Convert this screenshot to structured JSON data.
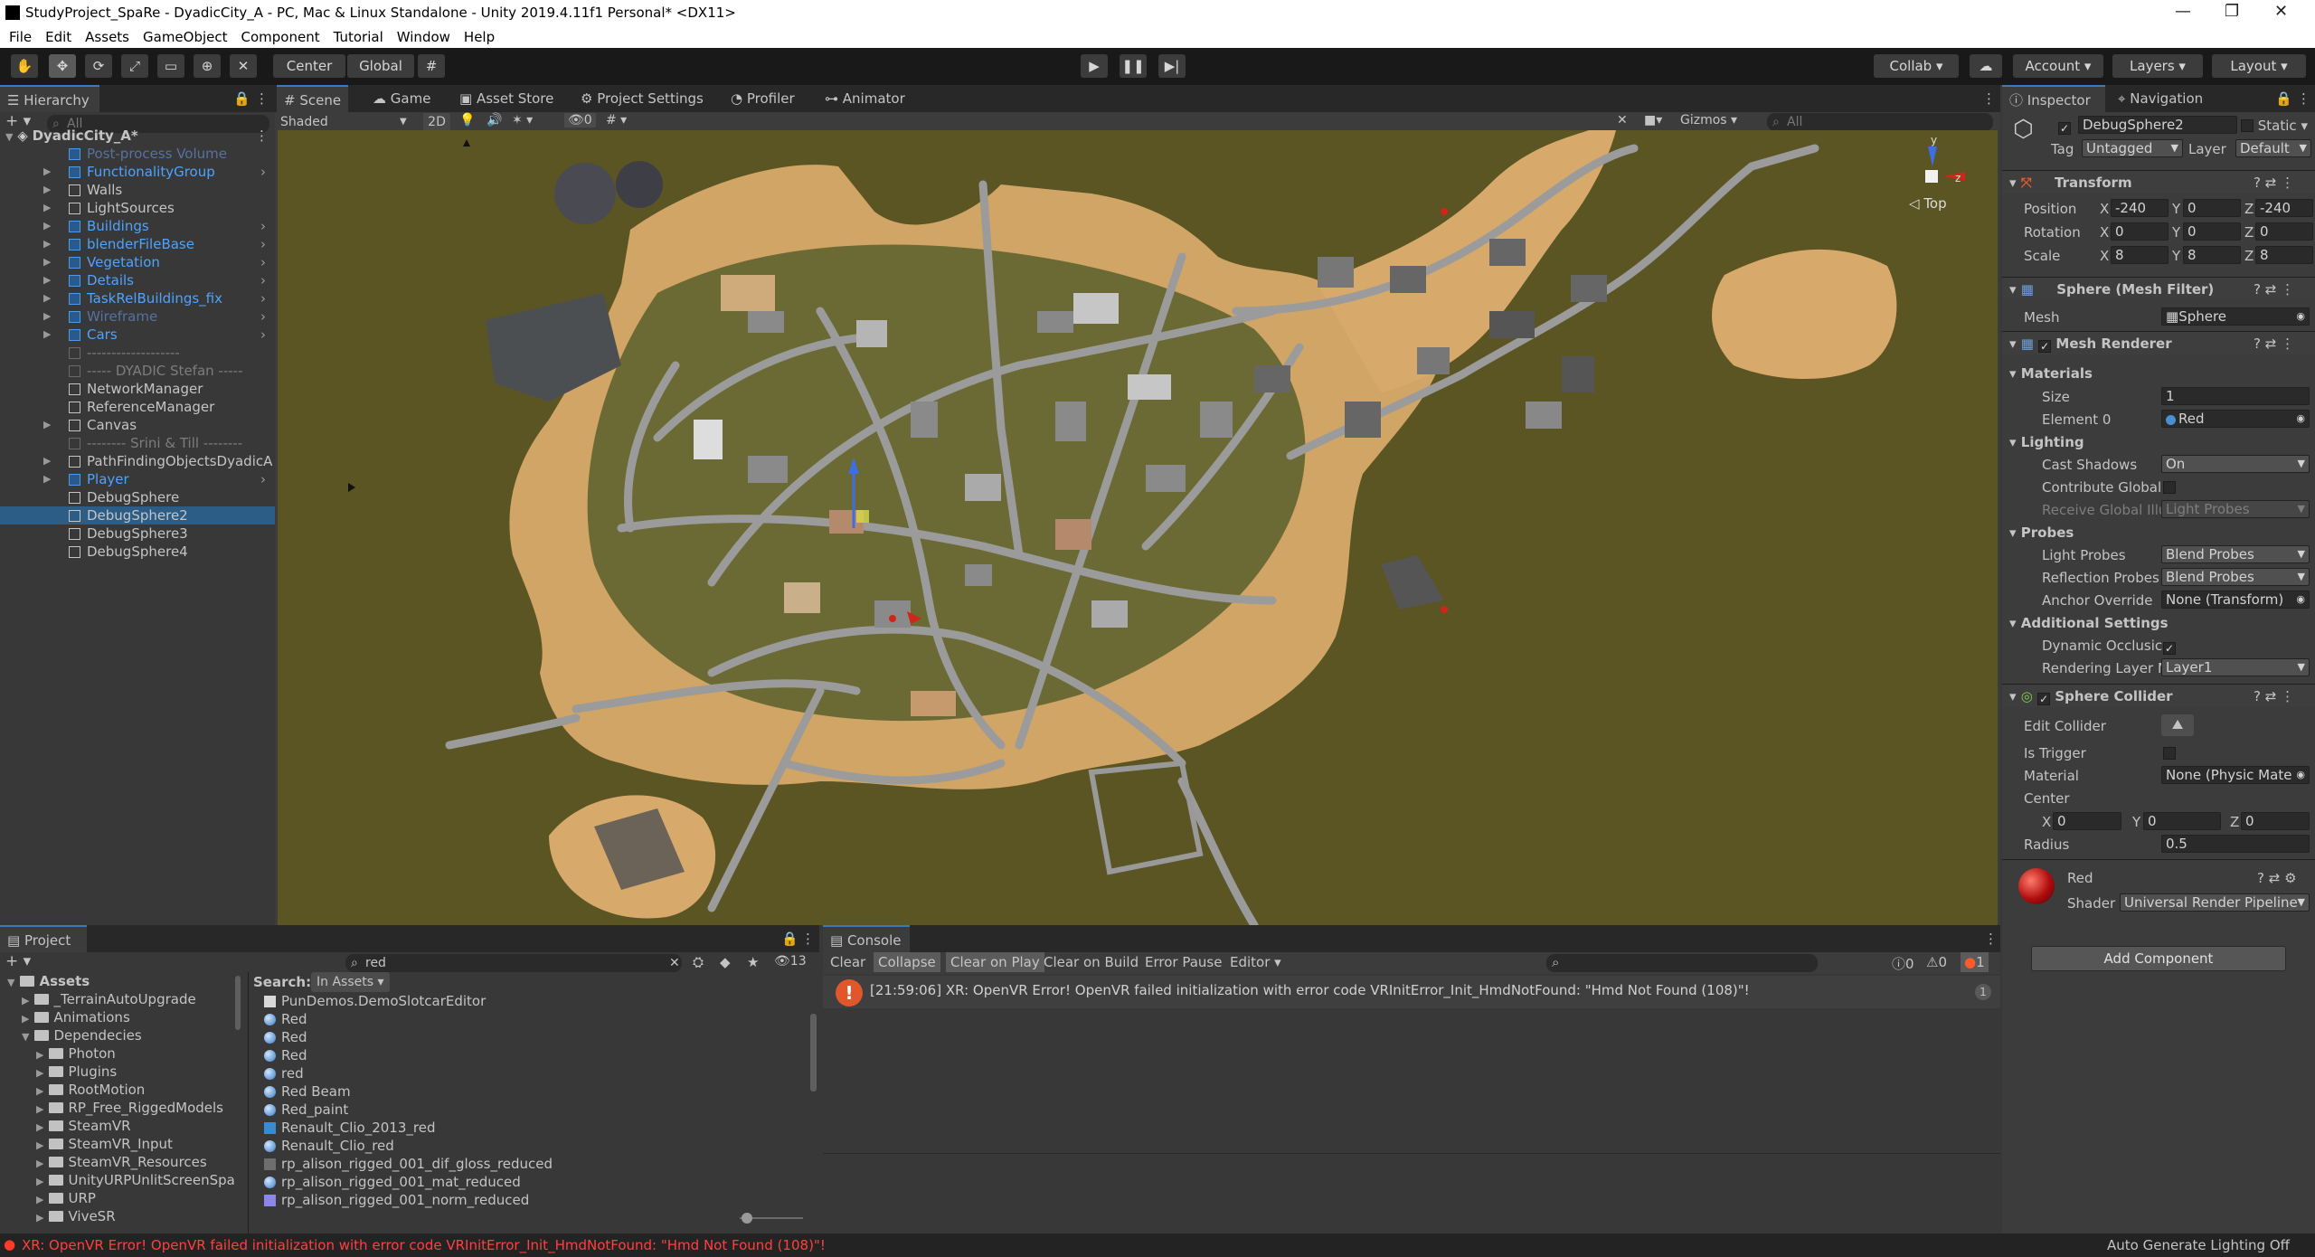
{
  "titlebar": {
    "title": "StudyProject_SpaRe - DyadicCity_A - PC, Mac & Linux Standalone - Unity 2019.4.11f1 Personal* <DX11>",
    "minimize": "—",
    "maximize": "❐",
    "close": "✕"
  },
  "menu": [
    "File",
    "Edit",
    "Assets",
    "GameObject",
    "Component",
    "Tutorial",
    "Window",
    "Help"
  ],
  "toolbar": {
    "pivot": "Center",
    "space": "Global",
    "collab": "Collab ▾",
    "account": "Account",
    "layers": "Layers",
    "layout": "Layout"
  },
  "hierarchy": {
    "tab": "Hierarchy",
    "search_placeholder": "All",
    "scene": "DyadicCity_A*",
    "items": [
      {
        "label": "Post-process Volume",
        "style": "dim-blue"
      },
      {
        "label": "FunctionalityGroup",
        "style": "blue"
      },
      {
        "label": "Walls",
        "style": "normal"
      },
      {
        "label": "LightSources",
        "style": "normal"
      },
      {
        "label": "Buildings",
        "style": "blue"
      },
      {
        "label": "blenderFileBase",
        "style": "blue"
      },
      {
        "label": "Vegetation",
        "style": "blue"
      },
      {
        "label": "Details",
        "style": "blue"
      },
      {
        "label": "TaskRelBuildings_fix",
        "style": "blue"
      },
      {
        "label": "Wireframe",
        "style": "dim-blue"
      },
      {
        "label": "Cars",
        "style": "blue"
      },
      {
        "label": "-------------------",
        "style": "dim"
      },
      {
        "label": "----- DYADIC Stefan -----",
        "style": "dim"
      },
      {
        "label": "NetworkManager",
        "style": "normal"
      },
      {
        "label": "ReferenceManager",
        "style": "normal"
      },
      {
        "label": "Canvas",
        "style": "normal"
      },
      {
        "label": "-------- Srini & Till --------",
        "style": "dim"
      },
      {
        "label": "PathFindingObjectsDyadicA",
        "style": "normal"
      },
      {
        "label": "Player",
        "style": "blue"
      },
      {
        "label": "DebugSphere",
        "style": "normal"
      },
      {
        "label": "DebugSphere2",
        "style": "selected"
      },
      {
        "label": "DebugSphere3",
        "style": "normal"
      },
      {
        "label": "DebugSphere4",
        "style": "normal"
      }
    ]
  },
  "scene": {
    "tabs": [
      "Scene",
      "Game",
      "Asset Store",
      "Project Settings",
      "Profiler",
      "Animator"
    ],
    "shading": "Shaded",
    "mode2d": "2D",
    "hidden_count": "0",
    "gizmos": "Gizmos",
    "search_placeholder": "All",
    "view_label": "Top",
    "axis_y": "y",
    "axis_z": "z"
  },
  "inspector": {
    "tabs": [
      "Inspector",
      "Navigation"
    ],
    "object_name": "DebugSphere2",
    "static": "Static",
    "tag_label": "Tag",
    "tag": "Untagged",
    "layer_label": "Layer",
    "layer": "Default",
    "transform": {
      "title": "Transform",
      "position_label": "Position",
      "position": [
        "-240",
        "0",
        "-240"
      ],
      "rotation_label": "Rotation",
      "rotation": [
        "0",
        "0",
        "0"
      ],
      "scale_label": "Scale",
      "scale": [
        "8",
        "8",
        "8"
      ]
    },
    "mesh_filter": {
      "title": "Sphere (Mesh Filter)",
      "mesh_label": "Mesh",
      "mesh": "Sphere"
    },
    "mesh_renderer": {
      "title": "Mesh Renderer",
      "materials": "Materials",
      "size_label": "Size",
      "size": "1",
      "element0_label": "Element 0",
      "element0": "Red",
      "lighting": "Lighting",
      "cast_shadows_label": "Cast Shadows",
      "cast_shadows": "On",
      "contribute_gi_label": "Contribute Global",
      "receive_gi_label": "Receive Global Illu",
      "receive_gi": "Light Probes",
      "probes": "Probes",
      "light_probes_label": "Light Probes",
      "light_probes": "Blend Probes",
      "reflection_probes_label": "Reflection Probes",
      "reflection_probes": "Blend Probes",
      "anchor_override_label": "Anchor Override",
      "anchor_override": "None (Transform)",
      "additional": "Additional Settings",
      "dynamic_occlusion_label": "Dynamic Occlusic",
      "rendering_layer_label": "Rendering Layer M",
      "rendering_layer": "Layer1"
    },
    "sphere_collider": {
      "title": "Sphere Collider",
      "edit_collider_label": "Edit Collider",
      "is_trigger_label": "Is Trigger",
      "material_label": "Material",
      "material": "None (Physic Mate",
      "center_label": "Center",
      "center": [
        "0",
        "0",
        "0"
      ],
      "radius_label": "Radius",
      "radius": "0.5"
    },
    "material": {
      "name": "Red",
      "shader_label": "Shader",
      "shader": "Universal Render Pipeline"
    },
    "add_component": "Add Component"
  },
  "project": {
    "tab": "Project",
    "search_value": "red",
    "count": "13",
    "search_label": "Search:",
    "search_scope": "In Assets",
    "tree": [
      {
        "label": "Assets",
        "depth": 0,
        "bold": true
      },
      {
        "label": "_TerrainAutoUpgrade",
        "depth": 1
      },
      {
        "label": "Animations",
        "depth": 1
      },
      {
        "label": "Dependecies",
        "depth": 1
      },
      {
        "label": "Photon",
        "depth": 2
      },
      {
        "label": "Plugins",
        "depth": 2
      },
      {
        "label": "RootMotion",
        "depth": 2
      },
      {
        "label": "RP_Free_RiggedModels",
        "depth": 2
      },
      {
        "label": "SteamVR",
        "depth": 2
      },
      {
        "label": "SteamVR_Input",
        "depth": 2
      },
      {
        "label": "SteamVR_Resources",
        "depth": 2
      },
      {
        "label": "UnityURPUnlitScreenSpa",
        "depth": 2
      },
      {
        "label": "URP",
        "depth": 2
      },
      {
        "label": "ViveSR",
        "depth": 2
      }
    ],
    "results": [
      {
        "label": "PunDemos.DemoSlotcarEditor",
        "icon": "script"
      },
      {
        "label": "Red",
        "icon": "material"
      },
      {
        "label": "Red",
        "icon": "material"
      },
      {
        "label": "Red",
        "icon": "material"
      },
      {
        "label": "red",
        "icon": "material"
      },
      {
        "label": "Red Beam",
        "icon": "material"
      },
      {
        "label": "Red_paint",
        "icon": "material"
      },
      {
        "label": "Renault_Clio_2013_red",
        "icon": "prefab"
      },
      {
        "label": "Renault_Clio_red",
        "icon": "material"
      },
      {
        "label": "rp_alison_rigged_001_dif_gloss_reduced",
        "icon": "texture"
      },
      {
        "label": "rp_alison_rigged_001_mat_reduced",
        "icon": "material"
      },
      {
        "label": "rp_alison_rigged_001_norm_reduced",
        "icon": "texture-purple"
      }
    ]
  },
  "console": {
    "tab": "Console",
    "buttons": [
      "Clear",
      "Collapse",
      "Clear on Play",
      "Clear on Build",
      "Error Pause",
      "Editor ▾"
    ],
    "info_count": "0",
    "warn_count": "0",
    "error_count": "1",
    "message": "[21:59:06] XR: OpenVR Error! OpenVR failed initialization with error code VRInitError_Init_HmdNotFound: \"Hmd Not Found (108)\"!",
    "message_count": "1"
  },
  "statusbar": {
    "error": "XR: OpenVR Error! OpenVR failed initialization with error code VRInitError_Init_HmdNotFound: \"Hmd Not Found (108)\"!",
    "right": "Auto Generate Lighting Off"
  },
  "colors": {
    "accent": "#2c5d87",
    "error": "#e0572c",
    "terrain": "#5b5423",
    "sand": "#d6a764",
    "road": "#8a8a8a"
  }
}
